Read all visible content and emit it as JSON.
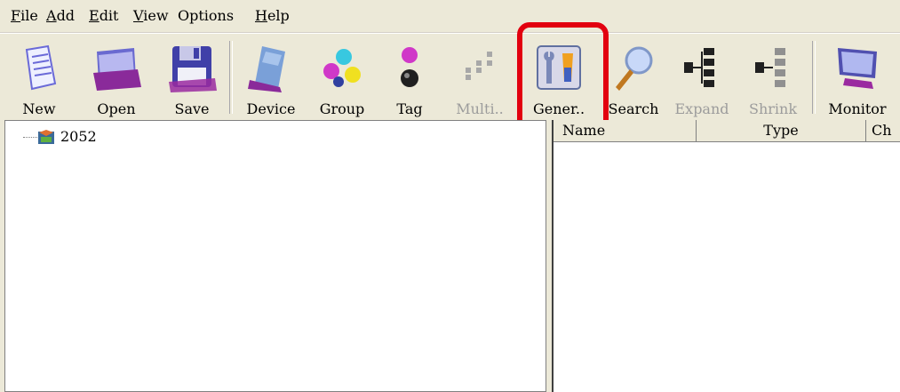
{
  "menu": {
    "items": [
      {
        "key": "F",
        "rest": "ile"
      },
      {
        "key": "A",
        "rest": "dd"
      },
      {
        "key": "E",
        "rest": "dit"
      },
      {
        "key": "V",
        "rest": "iew"
      },
      {
        "key": "",
        "rest": "Options"
      },
      {
        "key": "H",
        "rest": "elp"
      }
    ]
  },
  "toolbar": {
    "new": "New",
    "open": "Open",
    "save": "Save",
    "device": "Device",
    "group": "Group",
    "tag": "Tag",
    "multi": "Multi..",
    "gener": "Gener..",
    "search": "Search",
    "expand": "Expand",
    "shrink": "Shrink",
    "monitor": "Monitor"
  },
  "tree": {
    "root_label": "2052"
  },
  "table": {
    "columns": [
      "Name",
      "Type",
      "Ch"
    ]
  },
  "colors": {
    "highlight": "#e2000f",
    "background": "#ece9d8"
  }
}
